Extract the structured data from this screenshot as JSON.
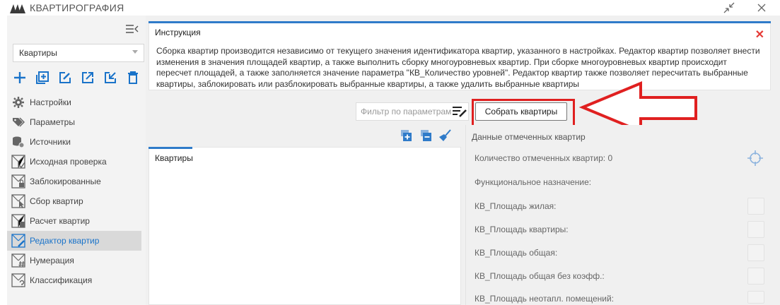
{
  "app": {
    "title": "КВАРТИРОГРАФИЯ"
  },
  "sidebar": {
    "dropdown_value": "Квартиры",
    "items": [
      {
        "label": "Настройки",
        "icon": "gear-icon"
      },
      {
        "label": "Параметры",
        "icon": "tags-icon"
      },
      {
        "label": "Источники",
        "icon": "database-gear-icon"
      },
      {
        "label": "Исходная проверка",
        "icon": "plan-check-icon"
      },
      {
        "label": "Заблокированные",
        "icon": "plan-lock-icon"
      },
      {
        "label": "Сбор квартир",
        "icon": "plan-cursor-icon"
      },
      {
        "label": "Расчет квартир",
        "icon": "plan-calc-icon"
      },
      {
        "label": "Редактор квартир",
        "icon": "plan-edit-icon"
      },
      {
        "label": "Нумерация",
        "icon": "plan-hash-icon"
      },
      {
        "label": "Классификация",
        "icon": "plan-question-icon"
      }
    ],
    "active_index": 7
  },
  "instruction": {
    "title": "Инструкция",
    "lines": [
      "Сборка квартир производится независимо от текущего значения идентификатора квартир, указанного в настройках. Редактор квартир позволяет внести",
      "изменения в значения площадей квартир, а также выполнить сборку многоуровневых квартир. При сборке многоуровневых квартир происходит",
      "пересчет площадей, а также заполняется значение параметра \"КВ_Количество уровней\". Редактор квартир также позволяет пересчитать выбранные",
      "квартиры, заблокировать или разблокировать выбранные квартиры, а также удалить выбранные квартиры"
    ]
  },
  "filter": {
    "placeholder": "Фильтр по параметрам"
  },
  "collect_button": {
    "label": "Собрать квартиры"
  },
  "list": {
    "title": "Квартиры"
  },
  "data_panel": {
    "title": "Данные отмеченных квартир",
    "count_label": "Количество отмеченных квартир: 0",
    "function_label": "Функциональное назначение:",
    "params": [
      "КВ_Площадь жилая:",
      "КВ_Площадь квартиры:",
      "КВ_Площадь общая:",
      "КВ_Площадь общая без коэфф.:",
      "КВ_Площадь неотапл. помещений:"
    ]
  },
  "colors": {
    "accent": "#2f7bc9",
    "highlight": "#e02020",
    "active_text": "#1a73c9"
  }
}
